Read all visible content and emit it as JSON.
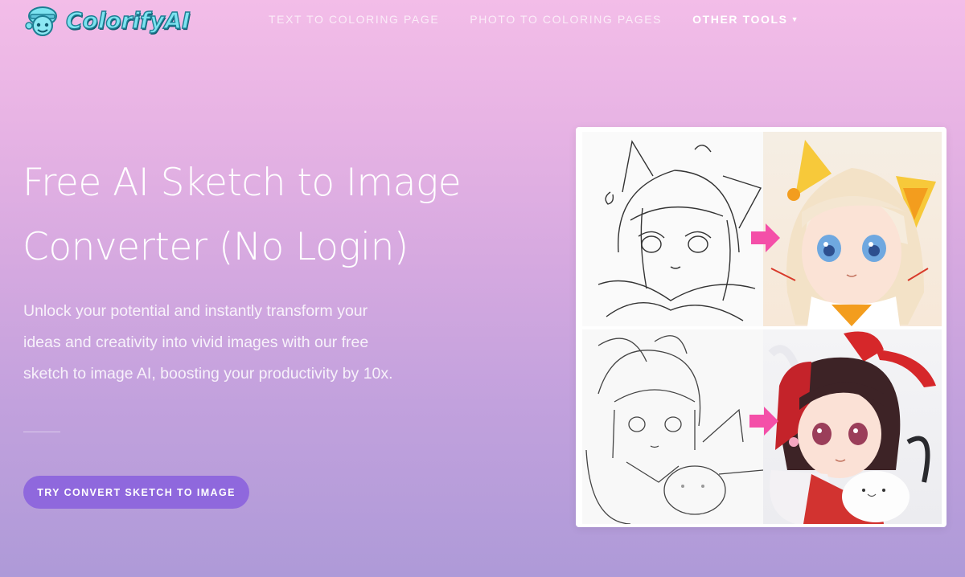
{
  "header": {
    "logo_text": "ColorifyAI",
    "nav": [
      {
        "label": "TEXT TO COLORING PAGE"
      },
      {
        "label": "PHOTO TO COLORING PAGES"
      },
      {
        "label": "OTHER TOOLS"
      }
    ]
  },
  "hero": {
    "title_line1": "Free AI Sketch to Image",
    "title_line2": "Converter (No Login)",
    "description_line1": "Unlock your potential and instantly transform your",
    "description_line2": "ideas and creativity into vivid images with our free",
    "description_line3": "sketch to image AI, boosting your productivity by 10x.",
    "cta_label": "TRY CONVERT SKETCH TO IMAGE"
  },
  "colors": {
    "accent": "#8f68dd",
    "logo": "#7de3f0",
    "arrow": "#f44fa8"
  },
  "icons": [
    "logo-mascot-icon",
    "chevron-down-icon",
    "arrow-right-icon"
  ]
}
